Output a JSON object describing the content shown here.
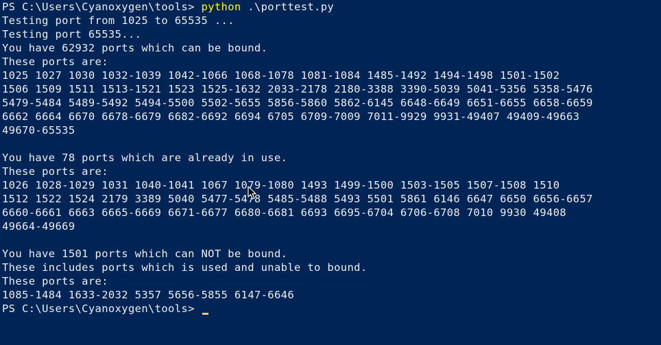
{
  "terminal": {
    "prompt": "PS C:\\Users\\Cyanoxygen\\tools> ",
    "command": "python",
    "args": " .\\porttest.py",
    "lines": [
      "Testing port from 1025 to 65535 ...",
      "Testing port 65535...",
      "You have 62932 ports which can be bound.",
      "These ports are:",
      "1025 1027 1030 1032-1039 1042-1066 1068-1078 1081-1084 1485-1492 1494-1498 1501-1502",
      "1506 1509 1511 1513-1521 1523 1525-1632 2033-2178 2180-3388 3390-5039 5041-5356 5358-5476",
      "5479-5484 5489-5492 5494-5500 5502-5655 5856-5860 5862-6145 6648-6649 6651-6655 6658-6659",
      "6662 6664 6670 6678-6679 6682-6692 6694 6705 6709-7009 7011-9929 9931-49407 49409-49663",
      "49670-65535",
      "",
      "You have 78 ports which are already in use.",
      "These ports are:",
      "1026 1028-1029 1031 1040-1041 1067 1079-1080 1493 1499-1500 1503-1505 1507-1508 1510",
      "1512 1522 1524 2179 3389 5040 5477-5478 5485-5488 5493 5501 5861 6146 6647 6650 6656-6657",
      "6660-6661 6663 6665-6669 6671-6677 6680-6681 6693 6695-6704 6706-6708 7010 9930 49408",
      "49664-49669",
      "",
      "You have 1501 ports which can NOT be bound.",
      "These includes ports which is used and unable to bound.",
      "These ports are:",
      "1085-1484 1633-2032 5357 5656-5855 6147-6646"
    ],
    "final_prompt": "PS C:\\Users\\Cyanoxygen\\tools> "
  },
  "colors": {
    "background": "#012456",
    "text": "#eeedf0",
    "command": "#ffff00",
    "cursor": "#f5c96a"
  },
  "icons": {
    "mouse_pointer": "arrow-pointer-icon"
  }
}
